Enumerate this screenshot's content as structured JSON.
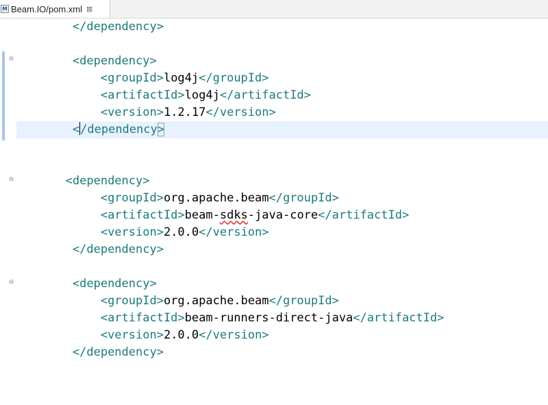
{
  "tab": {
    "title": "Beam.IO/pom.xml",
    "icon": "xml-file-icon",
    "close_glyph": "⊠"
  },
  "editor": {
    "lines": {
      "l1": {
        "indent": "        ",
        "open": "</dependency>"
      },
      "l3": {
        "indent": "        ",
        "open": "<dependency>"
      },
      "l4": {
        "indent": "            ",
        "open": "<groupId>",
        "text": "log4j",
        "close": "</groupId>"
      },
      "l5": {
        "indent": "            ",
        "open": "<artifactId>",
        "text": "log4j",
        "close": "</artifactId>"
      },
      "l6": {
        "indent": "            ",
        "open": "<version>",
        "text": "1.2.17",
        "close": "</version>"
      },
      "l7": {
        "indent": "        ",
        "first": "<",
        "rest": "/dependency",
        "last": ">"
      },
      "l10": {
        "indent": "       ",
        "open": "<dependency>"
      },
      "l11": {
        "indent": "            ",
        "open": "<groupId>",
        "text": "org.apache.beam",
        "close": "</groupId>"
      },
      "l12": {
        "indent": "            ",
        "open": "<artifactId>",
        "text_a": "beam-",
        "text_b": "sdks",
        "text_c": "-java-core",
        "close": "</artifactId>"
      },
      "l13": {
        "indent": "            ",
        "open": "<version>",
        "text": "2.0.0",
        "close": "</version>"
      },
      "l14": {
        "indent": "        ",
        "open": "</dependency>"
      },
      "l16": {
        "indent": "        ",
        "open": "<dependency>"
      },
      "l17": {
        "indent": "            ",
        "open": "<groupId>",
        "text": "org.apache.beam",
        "close": "</groupId>"
      },
      "l18": {
        "indent": "            ",
        "open": "<artifactId>",
        "text": "beam-runners-direct-java",
        "close": "</artifactId>"
      },
      "l19": {
        "indent": "            ",
        "open": "<version>",
        "text": "2.0.0",
        "close": "</version>"
      },
      "l20": {
        "indent": "        ",
        "open": "</dependency>"
      }
    }
  },
  "colors": {
    "tag": "#1a7a7a",
    "text": "#000000",
    "current_line": "#e8f2fe",
    "change_bar": "#a9c6e8"
  }
}
